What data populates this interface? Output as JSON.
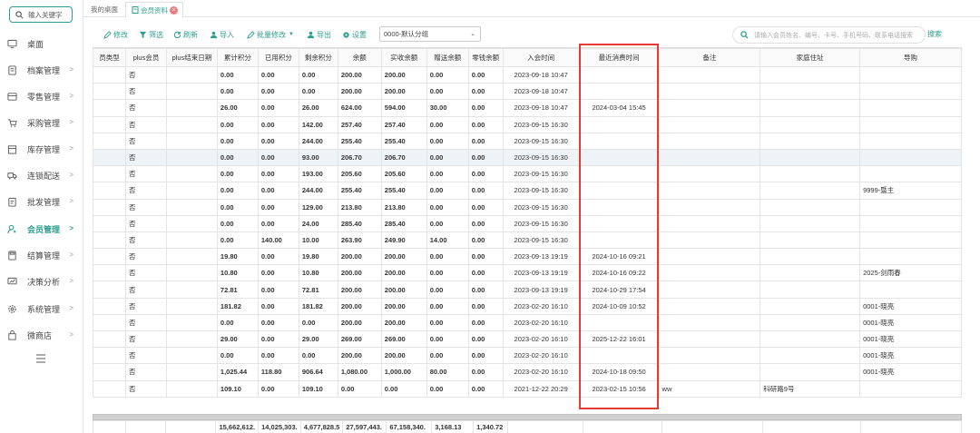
{
  "sidebar": {
    "search_placeholder": "输入关键字",
    "items": [
      {
        "label": "桌面",
        "icon": "monitor-icon",
        "arrow": ""
      },
      {
        "label": "档案管理",
        "icon": "file-icon",
        "arrow": ">"
      },
      {
        "label": "零售管理",
        "icon": "store-icon",
        "arrow": ">"
      },
      {
        "label": "采购管理",
        "icon": "cart-icon",
        "arrow": ">"
      },
      {
        "label": "库存管理",
        "icon": "box-icon",
        "arrow": ">"
      },
      {
        "label": "连锁配送",
        "icon": "truck-icon",
        "arrow": ">"
      },
      {
        "label": "批发管理",
        "icon": "clipboard-icon",
        "arrow": ">"
      },
      {
        "label": "会员管理",
        "icon": "user-icon",
        "arrow": ">"
      },
      {
        "label": "结算管理",
        "icon": "calculator-icon",
        "arrow": ">"
      },
      {
        "label": "决策分析",
        "icon": "chart-icon",
        "arrow": ">"
      },
      {
        "label": "系统管理",
        "icon": "gear-icon",
        "arrow": ">"
      },
      {
        "label": "微商店",
        "icon": "shop-icon",
        "arrow": ">"
      }
    ],
    "active_index": 7
  },
  "tabs": {
    "home": "我的桌面",
    "member": "会员资料",
    "close": "×"
  },
  "toolbar": {
    "edit": "修改",
    "filter": "筛选",
    "refresh": "刷新",
    "import": "导入",
    "batch_edit": "批量修改",
    "batch_edit_arrow": "▼",
    "export": "导出",
    "settings": "设置",
    "group_select": "0000-默认分组",
    "group_chevron": "⌄",
    "search_placeholder": "请输入会员姓名、编号、卡号、手机号码、联系电话搜索",
    "search_button": "搜索"
  },
  "table": {
    "columns": [
      "员类型",
      "plus会员",
      "plus结束日期",
      "累计积分",
      "已用积分",
      "剩余积分",
      "余额",
      "实收余额",
      "赠送余额",
      "零钱余额",
      "入会时间",
      "最近消费时间",
      "备注",
      "家庭住址",
      "导购"
    ],
    "rows": [
      [
        "",
        "否",
        "",
        "0.00",
        "0.00",
        "0.00",
        "200.00",
        "200.00",
        "0.00",
        "0.00",
        "2023-09-18 10:47",
        "",
        "",
        "",
        ""
      ],
      [
        "",
        "否",
        "",
        "0.00",
        "0.00",
        "0.00",
        "200.00",
        "200.00",
        "0.00",
        "0.00",
        "2023-09-18 10:47",
        "",
        "",
        "",
        ""
      ],
      [
        "",
        "否",
        "",
        "26.00",
        "0.00",
        "26.00",
        "624.00",
        "594.00",
        "30.00",
        "0.00",
        "2023-09-18 10:47",
        "2024-03-04 15:45",
        "",
        "",
        ""
      ],
      [
        "",
        "否",
        "",
        "0.00",
        "0.00",
        "142.00",
        "257.40",
        "257.40",
        "0.00",
        "0.00",
        "2023-09-15 16:30",
        "",
        "",
        "",
        ""
      ],
      [
        "",
        "否",
        "",
        "0.00",
        "0.00",
        "244.00",
        "255.40",
        "255.40",
        "0.00",
        "0.00",
        "2023-09-15 16:30",
        "",
        "",
        "",
        ""
      ],
      [
        "",
        "否",
        "",
        "0.00",
        "0.00",
        "93.00",
        "206.70",
        "206.70",
        "0.00",
        "0.00",
        "2023-09-15 16:30",
        "",
        "",
        "",
        ""
      ],
      [
        "",
        "否",
        "",
        "0.00",
        "0.00",
        "193.00",
        "205.60",
        "205.60",
        "0.00",
        "0.00",
        "2023-09-15 16:30",
        "",
        "",
        "",
        ""
      ],
      [
        "",
        "否",
        "",
        "0.00",
        "0.00",
        "244.00",
        "255.40",
        "255.40",
        "0.00",
        "0.00",
        "2023-09-15 16:30",
        "",
        "",
        "",
        "9999-暨主"
      ],
      [
        "",
        "否",
        "",
        "0.00",
        "0.00",
        "129.00",
        "213.80",
        "213.80",
        "0.00",
        "0.00",
        "2023-09-15 16:30",
        "",
        "",
        "",
        ""
      ],
      [
        "",
        "否",
        "",
        "0.00",
        "0.00",
        "24.00",
        "285.40",
        "285.40",
        "0.00",
        "0.00",
        "2023-09-15 16:30",
        "",
        "",
        "",
        ""
      ],
      [
        "",
        "否",
        "",
        "0.00",
        "140.00",
        "10.00",
        "263.90",
        "249.90",
        "14.00",
        "0.00",
        "2023-09-15 16:30",
        "",
        "",
        "",
        ""
      ],
      [
        "",
        "否",
        "",
        "19.80",
        "0.00",
        "19.80",
        "200.00",
        "200.00",
        "0.00",
        "0.00",
        "2023-09-13 19:19",
        "2024-10-16 09:21",
        "",
        "",
        ""
      ],
      [
        "",
        "否",
        "",
        "10.80",
        "0.00",
        "10.80",
        "200.00",
        "200.00",
        "0.00",
        "0.00",
        "2023-09-13 19:19",
        "2024-10-16 09:22",
        "",
        "",
        "2025-剑雨春"
      ],
      [
        "",
        "否",
        "",
        "72.81",
        "0.00",
        "72.81",
        "200.00",
        "200.00",
        "0.00",
        "0.00",
        "2023-09-13 19:19",
        "2024-10-29 17:54",
        "",
        "",
        ""
      ],
      [
        "",
        "否",
        "",
        "181.82",
        "0.00",
        "181.82",
        "200.00",
        "200.00",
        "0.00",
        "0.00",
        "2023-02-20 16:10",
        "2024-10-09 10:52",
        "",
        "",
        "0001-晓亮"
      ],
      [
        "",
        "否",
        "",
        "0.00",
        "0.00",
        "0.00",
        "200.00",
        "200.00",
        "0.00",
        "0.00",
        "2023-02-20 16:10",
        "",
        "",
        "",
        "0001-晓亮"
      ],
      [
        "",
        "否",
        "",
        "29.00",
        "0.00",
        "29.00",
        "269.00",
        "269.00",
        "0.00",
        "0.00",
        "2023-02-20 16:10",
        "2025-12-22 16:01",
        "",
        "",
        "0001-晓亮"
      ],
      [
        "",
        "否",
        "",
        "0.00",
        "0.00",
        "0.00",
        "200.00",
        "200.00",
        "0.00",
        "0.00",
        "2023-02-20 16:10",
        "",
        "",
        "",
        "0001-晓亮"
      ],
      [
        "",
        "否",
        "",
        "1,025.44",
        "118.80",
        "906.64",
        "1,080.00",
        "1,000.00",
        "80.00",
        "0.00",
        "2023-02-20 16:10",
        "2024-10-18 09:50",
        "",
        "",
        "0001-晓亮"
      ],
      [
        "",
        "否",
        "",
        "109.10",
        "0.00",
        "109.10",
        "0.00",
        "0.00",
        "0.00",
        "0.00",
        "2021-12-22 20:29",
        "2023-02-15 10:56",
        "ww",
        "科研路9号",
        ""
      ]
    ],
    "highlighted_row": 5,
    "totals": [
      "",
      "",
      "",
      "15,662,612.",
      "14,025,303.",
      "4,677,828.5",
      "27,597,443.",
      "67,158,340.",
      "3,168.13",
      "1,340.72",
      "",
      "",
      "",
      "",
      ""
    ]
  }
}
